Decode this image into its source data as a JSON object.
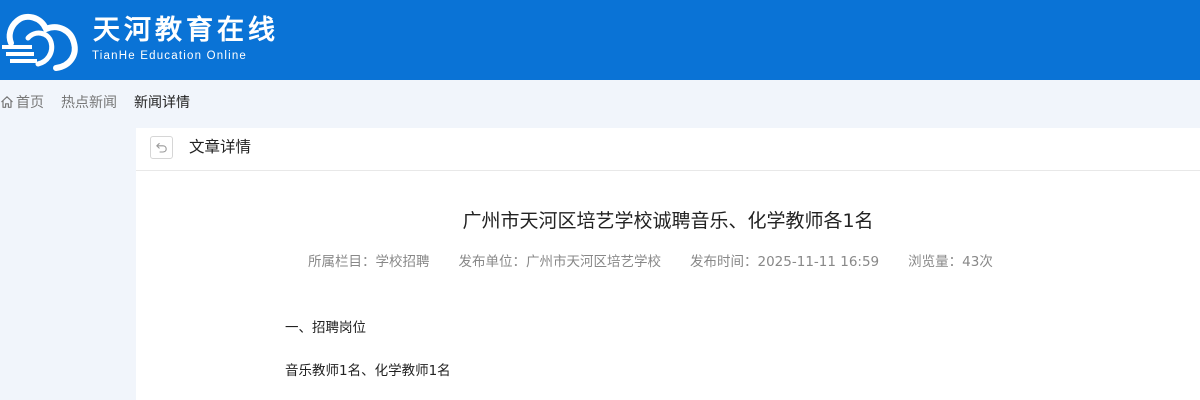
{
  "header": {
    "brand_title": "天河教育在线",
    "brand_subtitle": "TianHe Education Online"
  },
  "breadcrumb": {
    "home": "首页",
    "section": "热点新闻",
    "current": "新闻详情"
  },
  "panel": {
    "title": "文章详情"
  },
  "article": {
    "title": "广州市天河区培艺学校诚聘音乐、化学教师各1名",
    "meta": {
      "column": "所属栏目：学校招聘",
      "publisher": "发布单位：广州市天河区培艺学校",
      "time": "发布时间：2025-11-11 16:59",
      "views": "浏览量：43次"
    },
    "paragraphs": [
      "一、招聘岗位",
      "音乐教师1名、化学教师1名"
    ]
  },
  "colors": {
    "header_bg": "#0a73d6",
    "page_bg": "#f1f5fb",
    "panel_bg": "#ffffff"
  },
  "icons": {
    "logo": "cloud-logo-icon",
    "home": "home-icon",
    "back": "back-arrow-icon"
  }
}
